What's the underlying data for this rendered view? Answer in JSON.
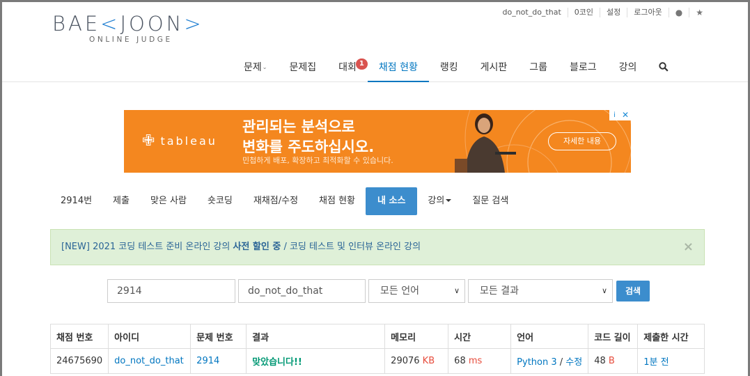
{
  "logo": {
    "left": "BAE",
    "mark": "<",
    "right": "JOON",
    "end": ">",
    "sub": "ONLINE JUDGE"
  },
  "topbar": {
    "user": "do_not_do_that",
    "coins": "0코인",
    "settings": "설정",
    "logout": "로그아웃",
    "globe_icon": "globe-icon",
    "star_icon": "star-icon"
  },
  "mainnav": {
    "items": [
      {
        "label": "문제"
      },
      {
        "label": "문제집"
      },
      {
        "label": "대회"
      },
      {
        "label": "채점 현황"
      },
      {
        "label": "랭킹"
      },
      {
        "label": "게시판"
      },
      {
        "label": "그룹"
      },
      {
        "label": "블로그"
      },
      {
        "label": "강의"
      }
    ],
    "contest_badge": "1",
    "active": "채점 현황"
  },
  "ad": {
    "brand": "tableau",
    "headline_1": "관리되는 분석으로",
    "headline_2": "변화를 주도하십시오.",
    "sub": "민첩하게 배포, 확장하고 최적화할 수 있습니다.",
    "button": "자세한 내용",
    "info": "i",
    "close": "✕"
  },
  "subnav": {
    "items": [
      "2914번",
      "제출",
      "맞은 사람",
      "숏코딩",
      "재채점/수정",
      "채점 현황",
      "내 소스",
      "강의",
      "질문 검색"
    ],
    "active": "내 소스"
  },
  "alert": {
    "part1": "[NEW] 2021 코딩 테스트 준비 온라인 강의 ",
    "bold": "사전 할인 중",
    "part2": " / 코딩 테스트 및 인터뷰 온라인 강의",
    "close": "×"
  },
  "search": {
    "problem": "2914",
    "user": "do_not_do_that",
    "language": "모든 언어",
    "result": "모든 결과",
    "button": "검색"
  },
  "table": {
    "headers": [
      "채점 번호",
      "아이디",
      "문제 번호",
      "결과",
      "메모리",
      "시간",
      "언어",
      "코드 길이",
      "제출한 시간"
    ],
    "rows": [
      {
        "id": "24675690",
        "user": "do_not_do_that",
        "problem": "2914",
        "result": "맞았습니다!!",
        "memory": "29076",
        "memory_unit": "KB",
        "time": "68",
        "time_unit": "ms",
        "language": "Python 3",
        "sep": "/",
        "edit": "수정",
        "length": "48",
        "length_unit": "B",
        "submitted": "1분 전"
      }
    ]
  }
}
